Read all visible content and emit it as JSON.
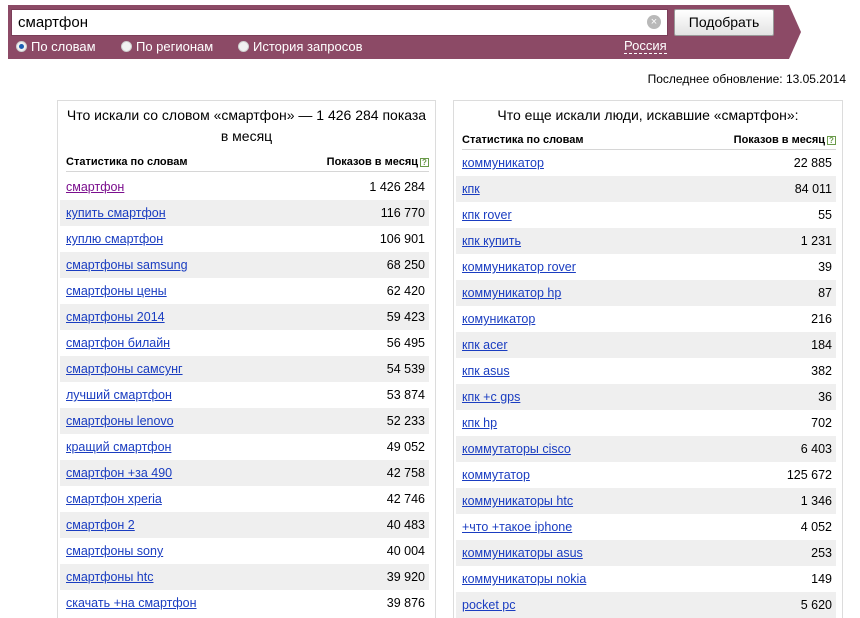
{
  "search": {
    "value": "смартфон",
    "submit_label": "Подобрать",
    "clear_icon": "×",
    "region": "Россия",
    "modes": [
      {
        "label": "По словам",
        "selected": true
      },
      {
        "label": "По регионам",
        "selected": false
      },
      {
        "label": "История запросов",
        "selected": false
      }
    ]
  },
  "updated": "Последнее обновление: 13.05.2014",
  "left": {
    "title": "Что искали со словом «смартфон» — 1 426 284 показа в месяц",
    "col_keyword": "Статистика по словам",
    "col_count": "Показов в месяц",
    "help_icon": "?",
    "rows": [
      {
        "kw": "смартфон",
        "count": "1 426 284"
      },
      {
        "kw": "купить смартфон",
        "count": "116 770"
      },
      {
        "kw": "куплю смартфон",
        "count": "106 901"
      },
      {
        "kw": "смартфоны samsung",
        "count": "68 250"
      },
      {
        "kw": "смартфоны цены",
        "count": "62 420"
      },
      {
        "kw": "смартфоны 2014",
        "count": "59 423"
      },
      {
        "kw": "смартфон билайн",
        "count": "56 495"
      },
      {
        "kw": "смартфоны самсунг",
        "count": "54 539"
      },
      {
        "kw": "лучший смартфон",
        "count": "53 874"
      },
      {
        "kw": "смартфоны lenovo",
        "count": "52 233"
      },
      {
        "kw": "кращий смартфон",
        "count": "49 052"
      },
      {
        "kw": "смартфон +за 490",
        "count": "42 758"
      },
      {
        "kw": "смартфон xperia",
        "count": "42 746"
      },
      {
        "kw": "смартфон 2",
        "count": "40 483"
      },
      {
        "kw": "смартфоны sony",
        "count": "40 004"
      },
      {
        "kw": "смартфоны htc",
        "count": "39 920"
      },
      {
        "kw": "скачать +на смартфон",
        "count": "39 876"
      }
    ]
  },
  "right": {
    "title": "Что еще искали люди, искавшие «смартфон»:",
    "col_keyword": "Статистика по словам",
    "col_count": "Показов в месяц",
    "help_icon": "?",
    "rows": [
      {
        "kw": "коммуникатор",
        "count": "22 885"
      },
      {
        "kw": "кпк",
        "count": "84 011"
      },
      {
        "kw": "кпк rover",
        "count": "55"
      },
      {
        "kw": "кпк купить",
        "count": "1 231"
      },
      {
        "kw": "коммуникатор rover",
        "count": "39"
      },
      {
        "kw": "коммуникатор hp",
        "count": "87"
      },
      {
        "kw": "комуникатор",
        "count": "216"
      },
      {
        "kw": "кпк acer",
        "count": "184"
      },
      {
        "kw": "кпк asus",
        "count": "382"
      },
      {
        "kw": "кпк +с gps",
        "count": "36"
      },
      {
        "kw": "кпк hp",
        "count": "702"
      },
      {
        "kw": "коммутаторы cisco",
        "count": "6 403"
      },
      {
        "kw": "коммутатор",
        "count": "125 672"
      },
      {
        "kw": "коммуникаторы htc",
        "count": "1 346"
      },
      {
        "kw": "+что +такое iphone",
        "count": "4 052"
      },
      {
        "kw": "коммуникаторы asus",
        "count": "253"
      },
      {
        "kw": "коммуникаторы nokia",
        "count": "149"
      },
      {
        "kw": "pocket pc",
        "count": "5 620"
      }
    ]
  }
}
